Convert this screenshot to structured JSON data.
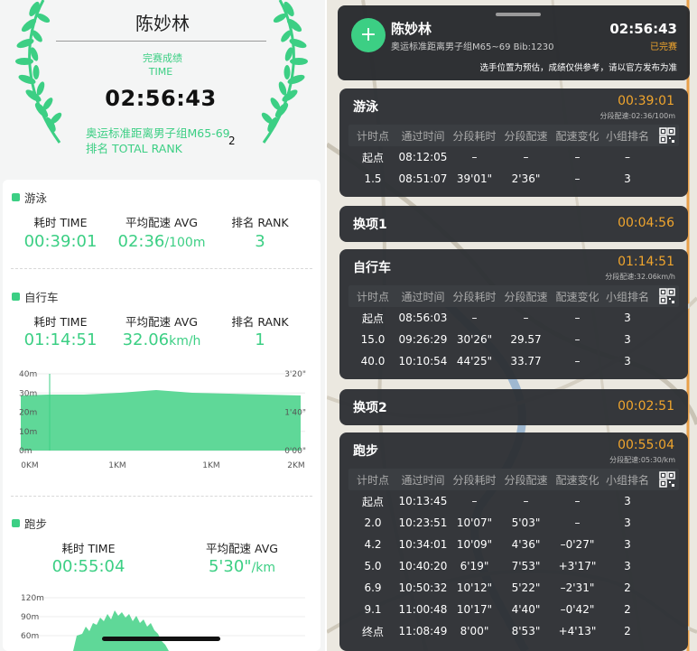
{
  "summary": {
    "athlete_name": "陈妙林",
    "finish_label": "完赛成绩",
    "time_label": "TIME",
    "finish_time": "02:56:43",
    "group_rank_text": "奥运标准距离男子组M65-69排名 TOTAL RANK",
    "group_rank_value": "2"
  },
  "labels": {
    "time_head": "耗时 TIME",
    "avg_head": "平均配速 AVG",
    "rank_head": "排名 RANK"
  },
  "swim": {
    "name": "游泳",
    "time": "00:39:01",
    "pace": "02:36",
    "pace_unit": "/100m",
    "rank": "3"
  },
  "bike": {
    "name": "自行车",
    "time": "01:14:51",
    "speed": "32.06",
    "speed_unit": "km/h",
    "rank": "1"
  },
  "run": {
    "name": "跑步",
    "time": "00:55:04",
    "pace": "5'30\"",
    "pace_unit": "/km"
  },
  "chart_data": [
    {
      "type": "area",
      "y_left_ticks": [
        "40m",
        "30m",
        "20m",
        "10m",
        "0m"
      ],
      "y_right_ticks": [
        "3'20\"",
        "",
        "1'40\"",
        "",
        "0'00\""
      ],
      "x_ticks": [
        "0KM",
        "1KM",
        "1KM",
        "2KM"
      ],
      "ylim": [
        0,
        40
      ]
    },
    {
      "type": "area",
      "y_left_ticks": [
        "120m",
        "90m",
        "60m"
      ]
    }
  ],
  "header": {
    "name": "陈妙林",
    "group": "奥运标准距离男子组M65~69 Bib:1230",
    "time": "02:56:43",
    "status": "已完赛",
    "note": "选手位置为预估，成绩仅供参考，请以官方发布为准"
  },
  "table_headers": [
    "计时点",
    "通过时间",
    "分段耗时",
    "分段配速",
    "配速变化",
    "小组排名"
  ],
  "segments": {
    "swim": {
      "title": "游泳",
      "time": "00:39:01",
      "pace": "分段配速:02:36/100m",
      "rows": [
        [
          "起点",
          "08:12:05",
          "–",
          "–",
          "–",
          "–"
        ],
        [
          "1.5",
          "08:51:07",
          "39'01\"",
          "2'36\"",
          "–",
          "3"
        ]
      ]
    },
    "t1": {
      "title": "换项1",
      "time": "00:04:56"
    },
    "bike": {
      "title": "自行车",
      "time": "01:14:51",
      "pace": "分段配速:32.06km/h",
      "rows": [
        [
          "起点",
          "08:56:03",
          "–",
          "–",
          "–",
          "3"
        ],
        [
          "15.0",
          "09:26:29",
          "30'26\"",
          "29.57",
          "–",
          "3"
        ],
        [
          "40.0",
          "10:10:54",
          "44'25\"",
          "33.77",
          "–",
          "3"
        ]
      ]
    },
    "t2": {
      "title": "换项2",
      "time": "00:02:51"
    },
    "run": {
      "title": "跑步",
      "time": "00:55:04",
      "pace": "分段配速:05:30/km",
      "rows": [
        [
          "起点",
          "10:13:45",
          "–",
          "–",
          "–",
          "3"
        ],
        [
          "2.0",
          "10:23:51",
          "10'07\"",
          "5'03\"",
          "–",
          "3"
        ],
        [
          "4.2",
          "10:34:01",
          "10'09\"",
          "4'36\"",
          "–0'27\"",
          "3"
        ],
        [
          "5.0",
          "10:40:20",
          "6'19\"",
          "7'53\"",
          "+3'17\"",
          "3"
        ],
        [
          "6.9",
          "10:50:32",
          "10'12\"",
          "5'22\"",
          "–2'31\"",
          "2"
        ],
        [
          "9.1",
          "11:00:48",
          "10'17\"",
          "4'40\"",
          "–0'42\"",
          "2"
        ],
        [
          "终点",
          "11:08:49",
          "8'00\"",
          "8'53\"",
          "+4'13\"",
          "2"
        ]
      ]
    }
  },
  "colors": {
    "accent": "#3ccf84",
    "orange": "#f0a52d",
    "panel": "#2d3034"
  }
}
